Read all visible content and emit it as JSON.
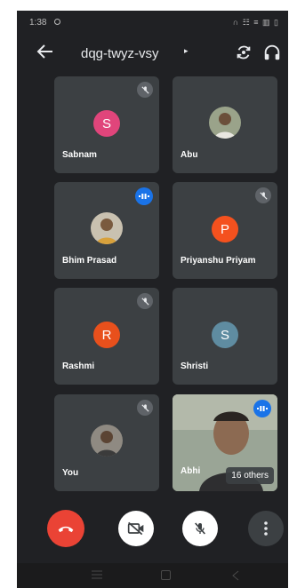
{
  "status_bar": {
    "time": "1:38",
    "icons_text": "∩ ☷ ≡ ▥ ▯"
  },
  "header": {
    "meeting_code": "dqg-twyz-vsy",
    "caret": "▸",
    "icons": [
      "back-arrow-icon",
      "switch-camera-icon",
      "headset-icon"
    ]
  },
  "participants": [
    {
      "name": "Sabnam",
      "initial": "S",
      "avatar_color": "#e0457b",
      "muted": true
    },
    {
      "name": "Abu",
      "photo": true,
      "muted": false
    },
    {
      "name": "Bhim Prasad",
      "photo": true,
      "speaking": true
    },
    {
      "name": "Priyanshu Priyam",
      "initial": "P",
      "avatar_color": "#f4511e",
      "muted": true
    },
    {
      "name": "Rashmi",
      "initial": "R",
      "avatar_color": "#e8501c",
      "muted": true
    },
    {
      "name": "Shristi",
      "initial": "S",
      "avatar_color": "#5f8ca1",
      "muted": false
    },
    {
      "name": "You",
      "photo": true,
      "muted": true
    },
    {
      "name": "Abhi",
      "video": true,
      "speaking": true
    }
  ],
  "others_chip": "16 others",
  "controls": {
    "icons": [
      "end-call-icon",
      "camera-off-icon",
      "mic-off-icon",
      "more-options-icon"
    ],
    "end_call_color": "#ea4335"
  },
  "colors": {
    "background": "#202124",
    "tile": "#3c4043",
    "speaking_badge": "#1a73e8"
  }
}
